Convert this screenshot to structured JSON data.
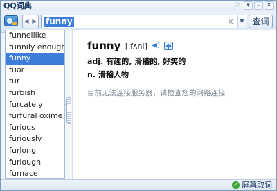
{
  "app": {
    "title": "QQ词典"
  },
  "search": {
    "value": "funny"
  },
  "toolbar": {
    "lookup_label": "查词"
  },
  "word_list": [
    "funnellike",
    "funnily enough",
    "funny",
    "fuor",
    "fur",
    "furbish",
    "furcately",
    "furfural oxime",
    "furious",
    "furiously",
    "furlong",
    "furlough",
    "furnace"
  ],
  "selected_word": "funny",
  "entry": {
    "headword": "funny",
    "phonetic": "[ˈfʌni]",
    "definitions": [
      {
        "pos": "adj.",
        "meaning": "有趣的, 滑稽的, 好笑的"
      },
      {
        "pos": "n.",
        "meaning": "滑稽人物"
      }
    ],
    "error_message": "目前无法连接服务器，请检查您的网络连接"
  },
  "status": {
    "screen_word_label": "屏幕取词",
    "screen_word_enabled": true
  },
  "colors": {
    "accent": "#3d7ddb",
    "frame": "#7a9cbf",
    "status_ok": "#3da43a"
  }
}
